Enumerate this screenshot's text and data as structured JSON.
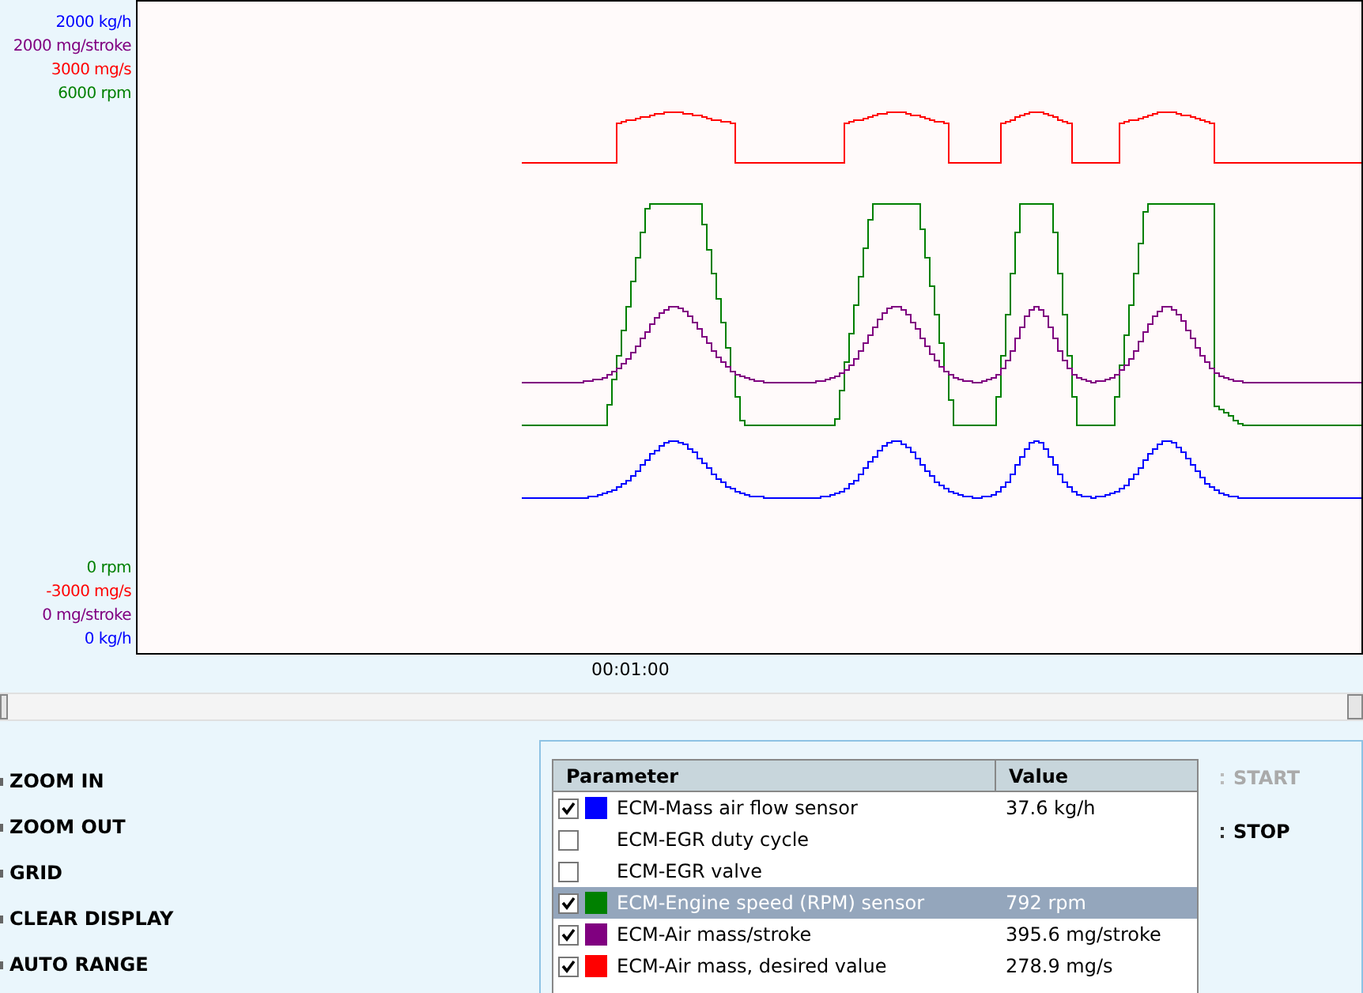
{
  "chart": {
    "top_labels": [
      {
        "text": "2000 kg/h",
        "color": "#0000ff"
      },
      {
        "text": "2000 mg/stroke",
        "color": "#800080"
      },
      {
        "text": "3000 mg/s",
        "color": "#ff0000"
      },
      {
        "text": "6000 rpm",
        "color": "#008000"
      }
    ],
    "bottom_labels": [
      {
        "text": "0 rpm",
        "color": "#008000"
      },
      {
        "text": "-3000 mg/s",
        "color": "#ff0000"
      },
      {
        "text": "0 mg/stroke",
        "color": "#800080"
      },
      {
        "text": "0 kg/h",
        "color": "#0000ff"
      }
    ],
    "time_label": "00:01:00"
  },
  "side_buttons": [
    "ZOOM IN",
    "ZOOM OUT",
    "GRID",
    "CLEAR DISPLAY",
    "AUTO RANGE"
  ],
  "table": {
    "columns": [
      "Parameter",
      "Value"
    ],
    "rows": [
      {
        "checked": true,
        "selected": false,
        "color": "#0000ff",
        "parameter": "ECM-Mass air flow sensor",
        "value": "37.6 kg/h"
      },
      {
        "checked": false,
        "selected": false,
        "parameter": "ECM-EGR duty cycle"
      },
      {
        "checked": false,
        "selected": false,
        "parameter": "ECM-EGR valve"
      },
      {
        "checked": true,
        "selected": true,
        "color": "#008000",
        "parameter": "ECM-Engine speed (RPM) sensor",
        "value": "792 rpm"
      },
      {
        "checked": true,
        "selected": false,
        "color": "#800080",
        "parameter": "ECM-Air mass/stroke",
        "value": "395.6 mg/stroke"
      },
      {
        "checked": true,
        "selected": false,
        "color": "#ff0000",
        "parameter": "ECM-Air mass, desired value",
        "value": "278.9 mg/s"
      }
    ]
  },
  "actions": [
    {
      "label": "START",
      "disabled": true
    },
    {
      "label": "STOP",
      "disabled": false
    }
  ]
}
